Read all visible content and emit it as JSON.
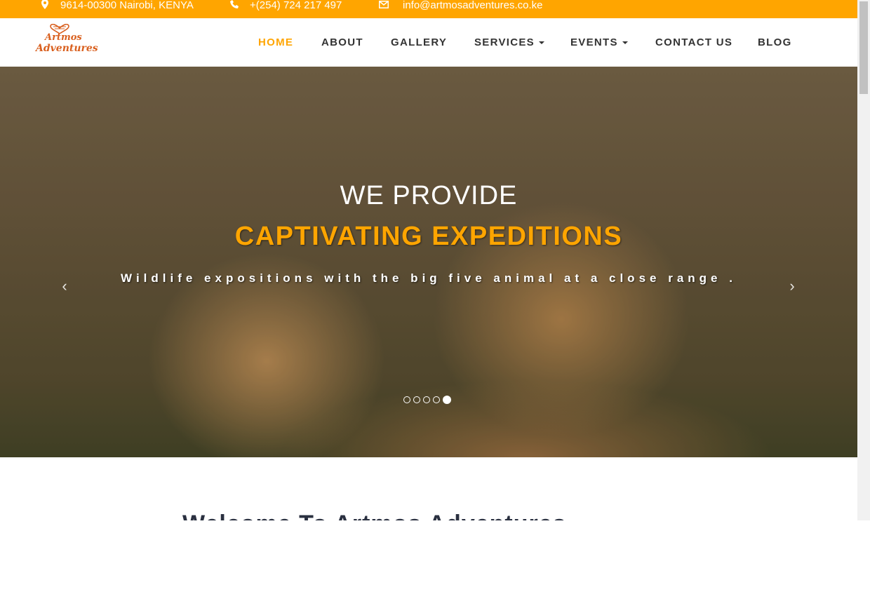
{
  "topbar": {
    "address": "9614-00300 Nairobi, KENYA",
    "phone": "+(254) 724 217 497",
    "email": "info@artmosadventures.co.ke",
    "icons": [
      "map-marker-icon",
      "phone-icon",
      "envelope-icon"
    ]
  },
  "logo": {
    "line1": "Artmos",
    "line2": "Adventures"
  },
  "nav": {
    "items": [
      {
        "label": "HOME",
        "active": true
      },
      {
        "label": "ABOUT"
      },
      {
        "label": "GALLERY"
      },
      {
        "label": "SERVICES",
        "dropdown": true
      },
      {
        "label": "EVENTS",
        "dropdown": true
      },
      {
        "label": "CONTACT US"
      },
      {
        "label": "BLOG"
      }
    ]
  },
  "hero": {
    "title": "WE PROVIDE",
    "highlight": "CAPTIVATING EXPEDITIONS",
    "subtitle": "Wildlife expositions with the big five animal at a close range .",
    "prev_arrow": "‹",
    "next_arrow": "›",
    "slides": 5,
    "active_slide": 5
  },
  "welcome": {
    "heading": "Welcome To Artmos Adventures"
  },
  "colors": {
    "accent": "#ffa500",
    "text": "#333333",
    "heading": "#2a3040"
  }
}
